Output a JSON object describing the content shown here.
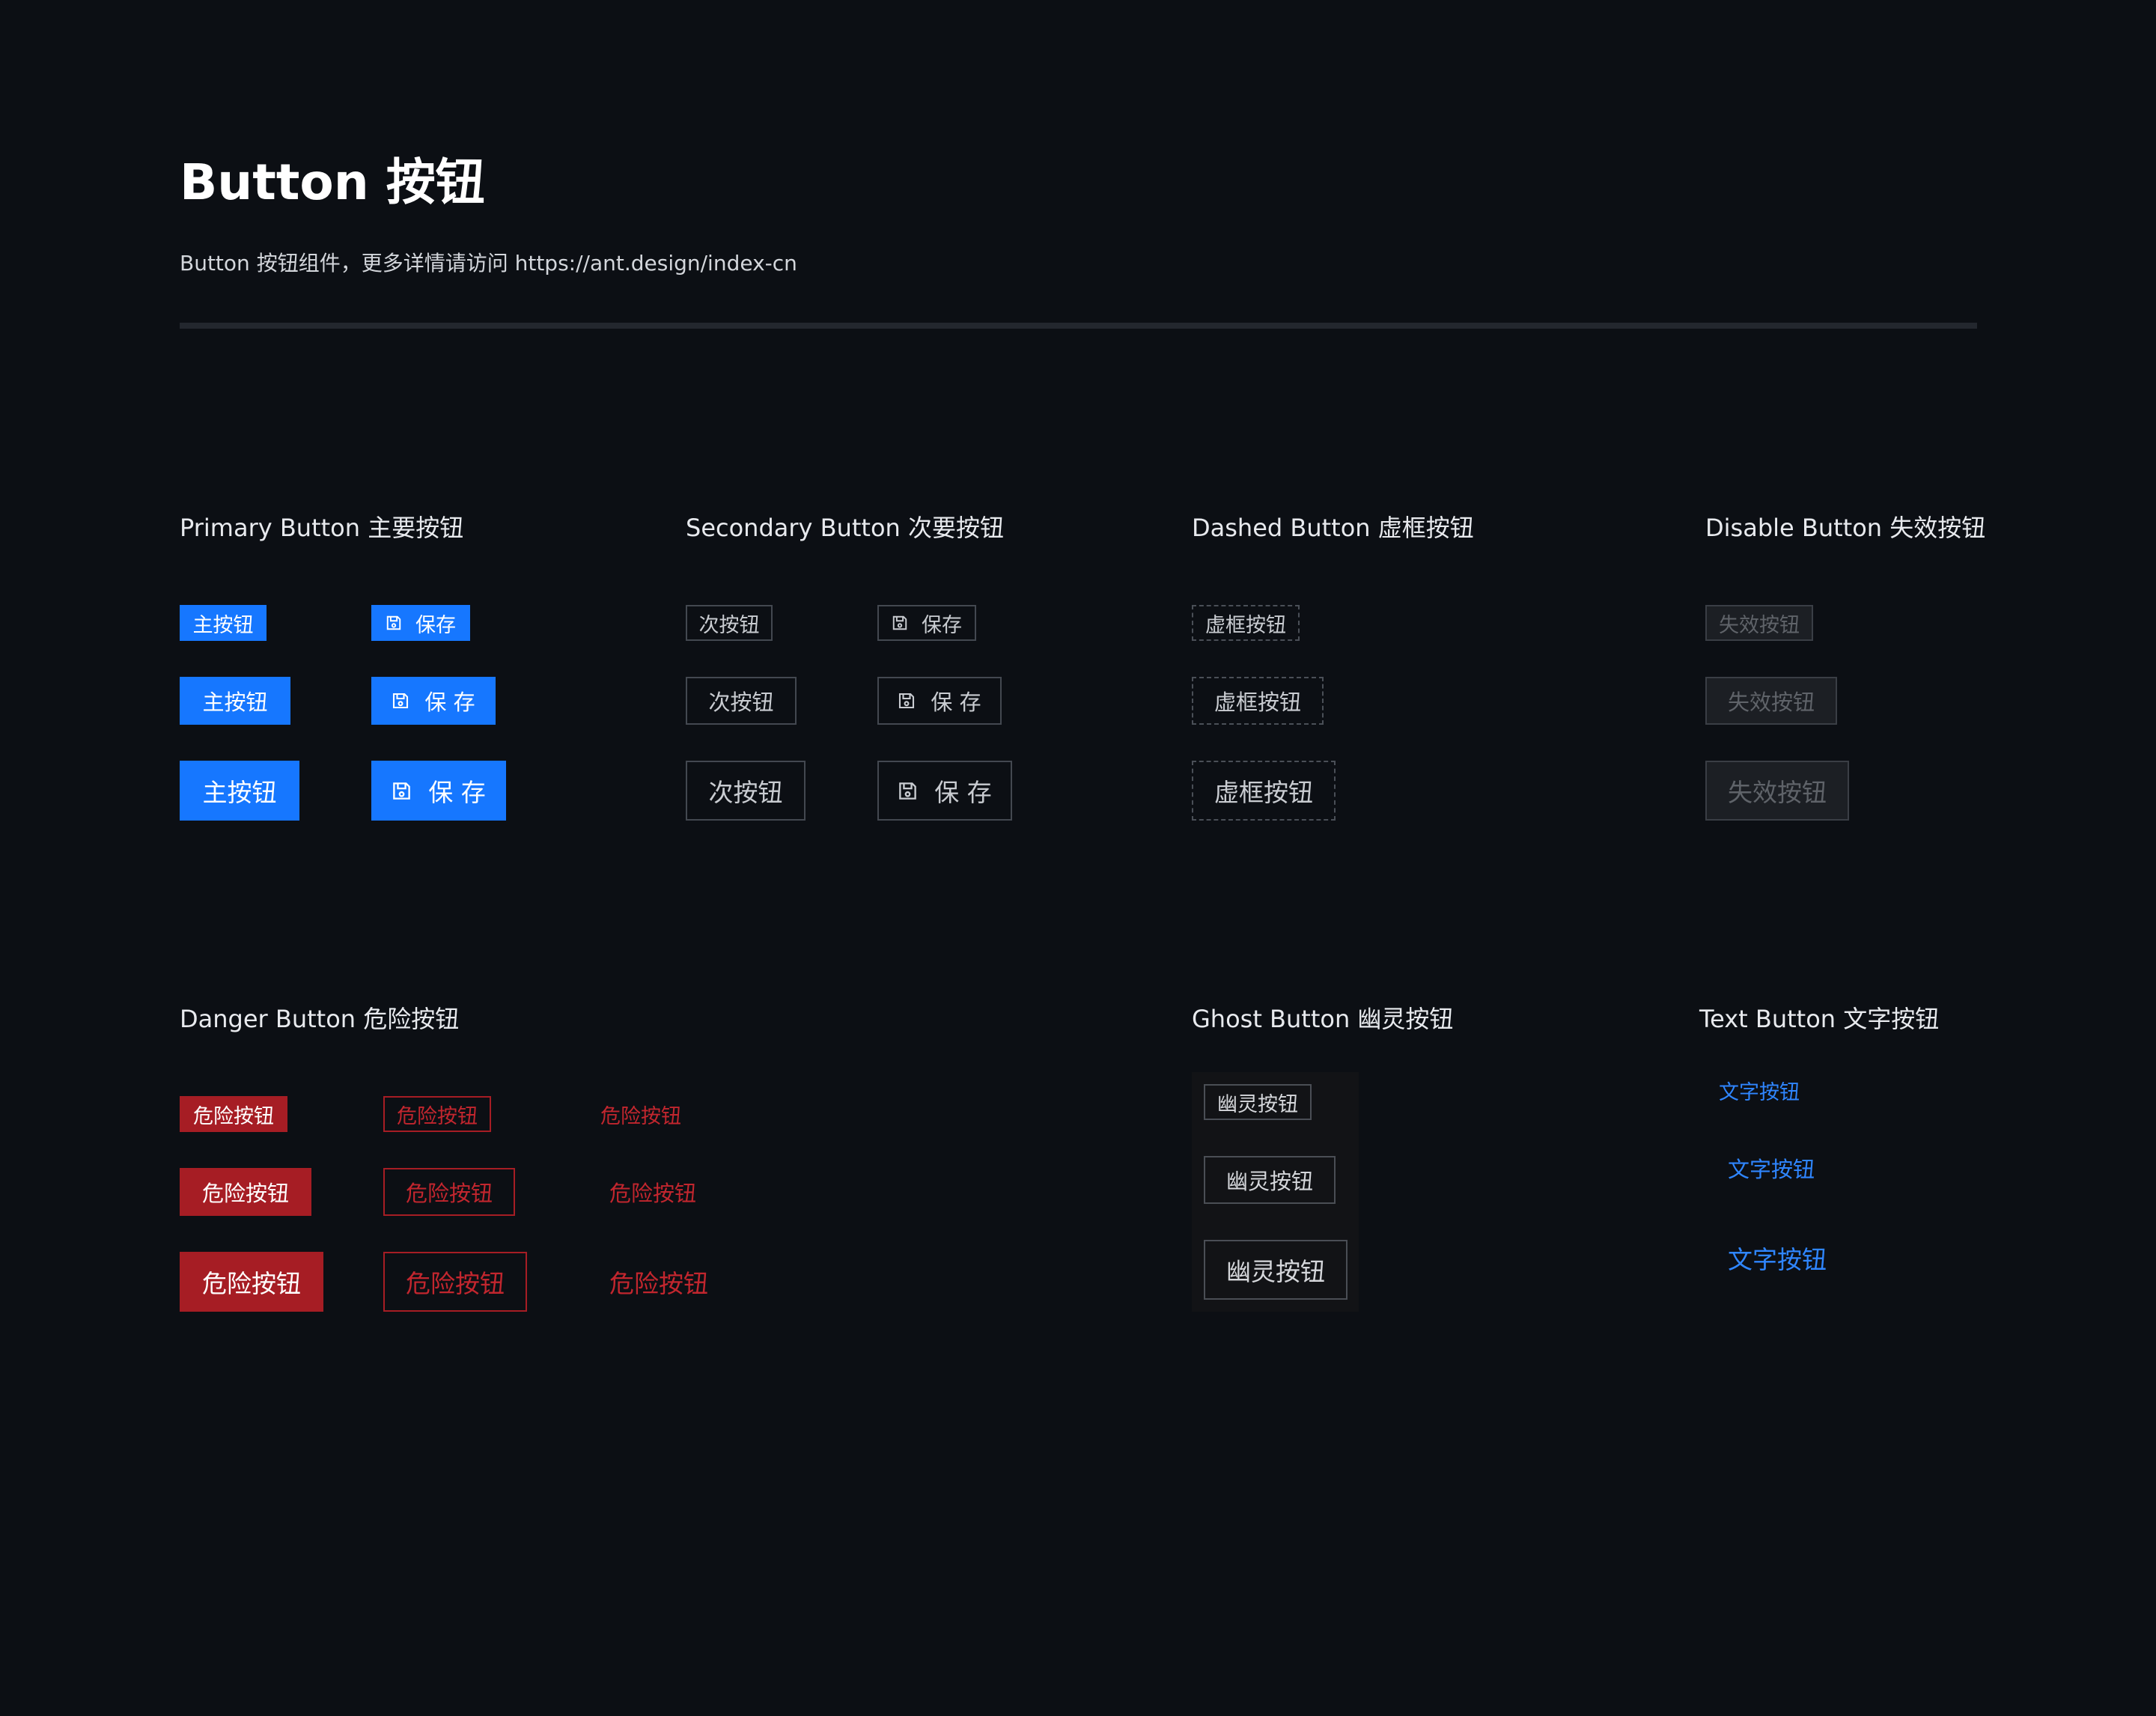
{
  "header": {
    "title": "Button 按钮",
    "description": "Button 按钮组件，更多详情请访问 https://ant.design/index-cn"
  },
  "sections": {
    "primary": {
      "title": "Primary Button 主要按钮",
      "label": "主按钮",
      "save_label": "保存",
      "save_label_spaced": "保 存"
    },
    "secondary": {
      "title": "Secondary Button 次要按钮",
      "label": "次按钮",
      "save_label": "保存",
      "save_label_spaced": "保 存"
    },
    "dashed": {
      "title": "Dashed Button 虚框按钮",
      "label": "虚框按钮"
    },
    "disabled": {
      "title": "Disable Button 失效按钮",
      "label": "失效按钮"
    },
    "danger": {
      "title": "Danger Button 危险按钮",
      "label": "危险按钮"
    },
    "ghost": {
      "title": "Ghost Button 幽灵按钮",
      "label": "幽灵按钮"
    },
    "text": {
      "title": "Text Button 文字按钮",
      "label": "文字按钮"
    }
  },
  "icons": {
    "save": "save-icon"
  },
  "colors": {
    "background": "#0c0f14",
    "primary": "#1677ff",
    "danger": "#a61d24",
    "danger_text": "#c2262e",
    "link": "#2f86ff"
  }
}
